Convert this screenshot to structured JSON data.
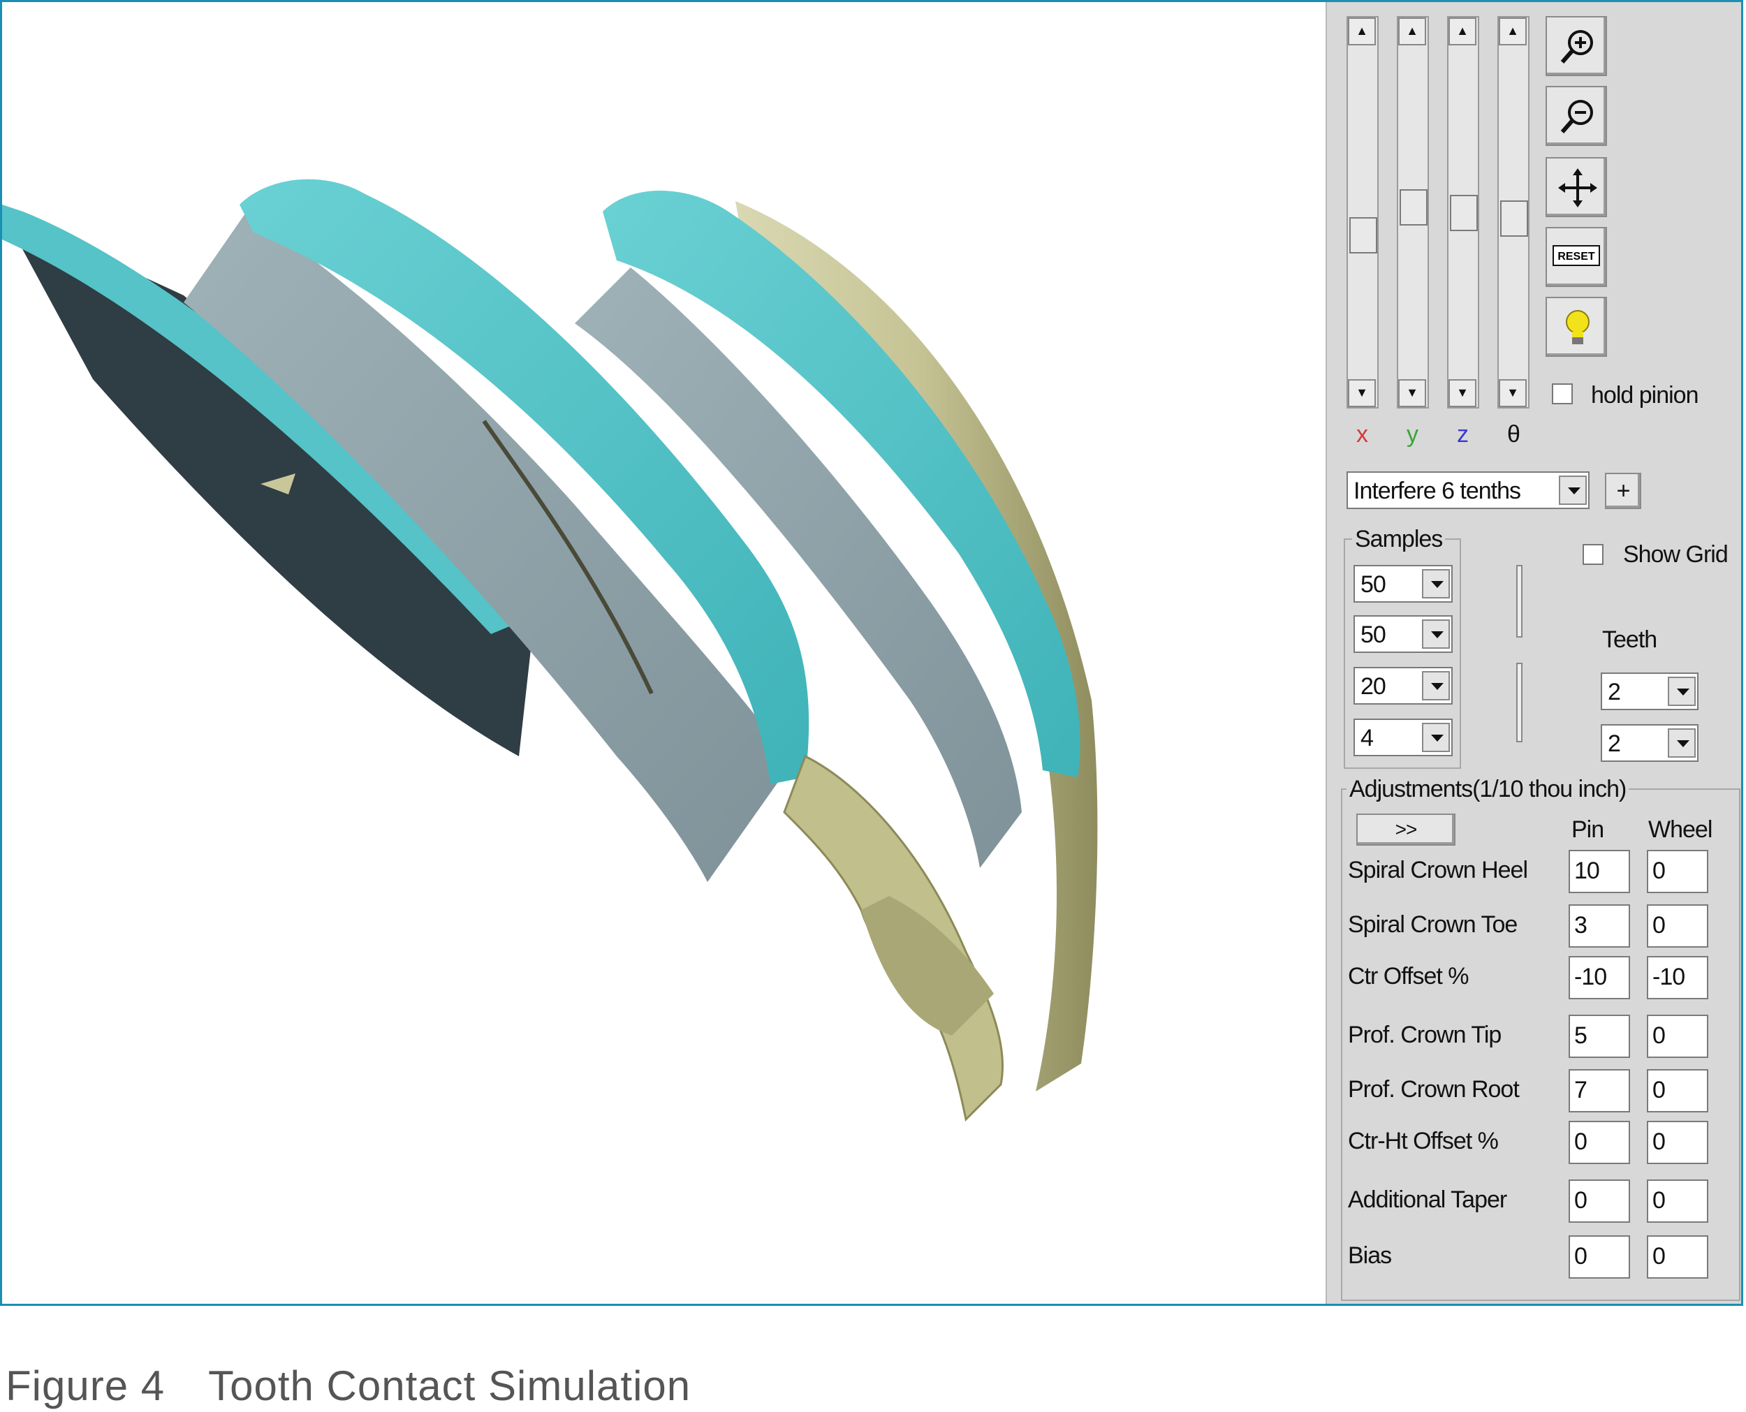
{
  "caption": {
    "prefix": "Figure 4",
    "title": "Tooth Contact Simulation"
  },
  "axes": {
    "x": "x",
    "y": "y",
    "z": "z",
    "theta": "θ"
  },
  "axis_colors": {
    "x": "#d23a3a",
    "y": "#3aa53a",
    "z": "#3a3ad2",
    "theta": "#222222"
  },
  "hold_pinion": {
    "label": "hold pinion",
    "checked": false
  },
  "reset_label": "RESET",
  "mode": {
    "selected": "Interfere 6 tenths",
    "plus": "+"
  },
  "samples": {
    "title": "Samples",
    "values": [
      "50",
      "50",
      "20",
      "4"
    ]
  },
  "show_grid": {
    "label": "Show Grid",
    "checked": false
  },
  "teeth": {
    "title": "Teeth",
    "values": [
      "2",
      "2"
    ]
  },
  "adjustments": {
    "title": "Adjustments(1/10 thou inch)",
    "expand_label": ">>",
    "col_pin": "Pin",
    "col_wheel": "Wheel",
    "rows": [
      {
        "label": "Spiral Crown Heel",
        "pin": "10",
        "wheel": "0"
      },
      {
        "label": "Spiral Crown Toe",
        "pin": "3",
        "wheel": "0"
      },
      {
        "label": "Ctr Offset %",
        "pin": "-10",
        "wheel": "-10"
      },
      {
        "label": "Prof. Crown Tip",
        "pin": "5",
        "wheel": "0"
      },
      {
        "label": "Prof. Crown Root",
        "pin": "7",
        "wheel": "0"
      },
      {
        "label": "Ctr-Ht Offset %",
        "pin": "0",
        "wheel": "0"
      },
      {
        "label": "Additional Taper",
        "pin": "0",
        "wheel": "0"
      },
      {
        "label": "Bias",
        "pin": "0",
        "wheel": "0"
      }
    ]
  },
  "colors": {
    "frame": "#1a8fb5",
    "pinion": "#5cc4c8",
    "pinion_flank": "#8fa3aa",
    "wheel": "#c9c79a"
  }
}
